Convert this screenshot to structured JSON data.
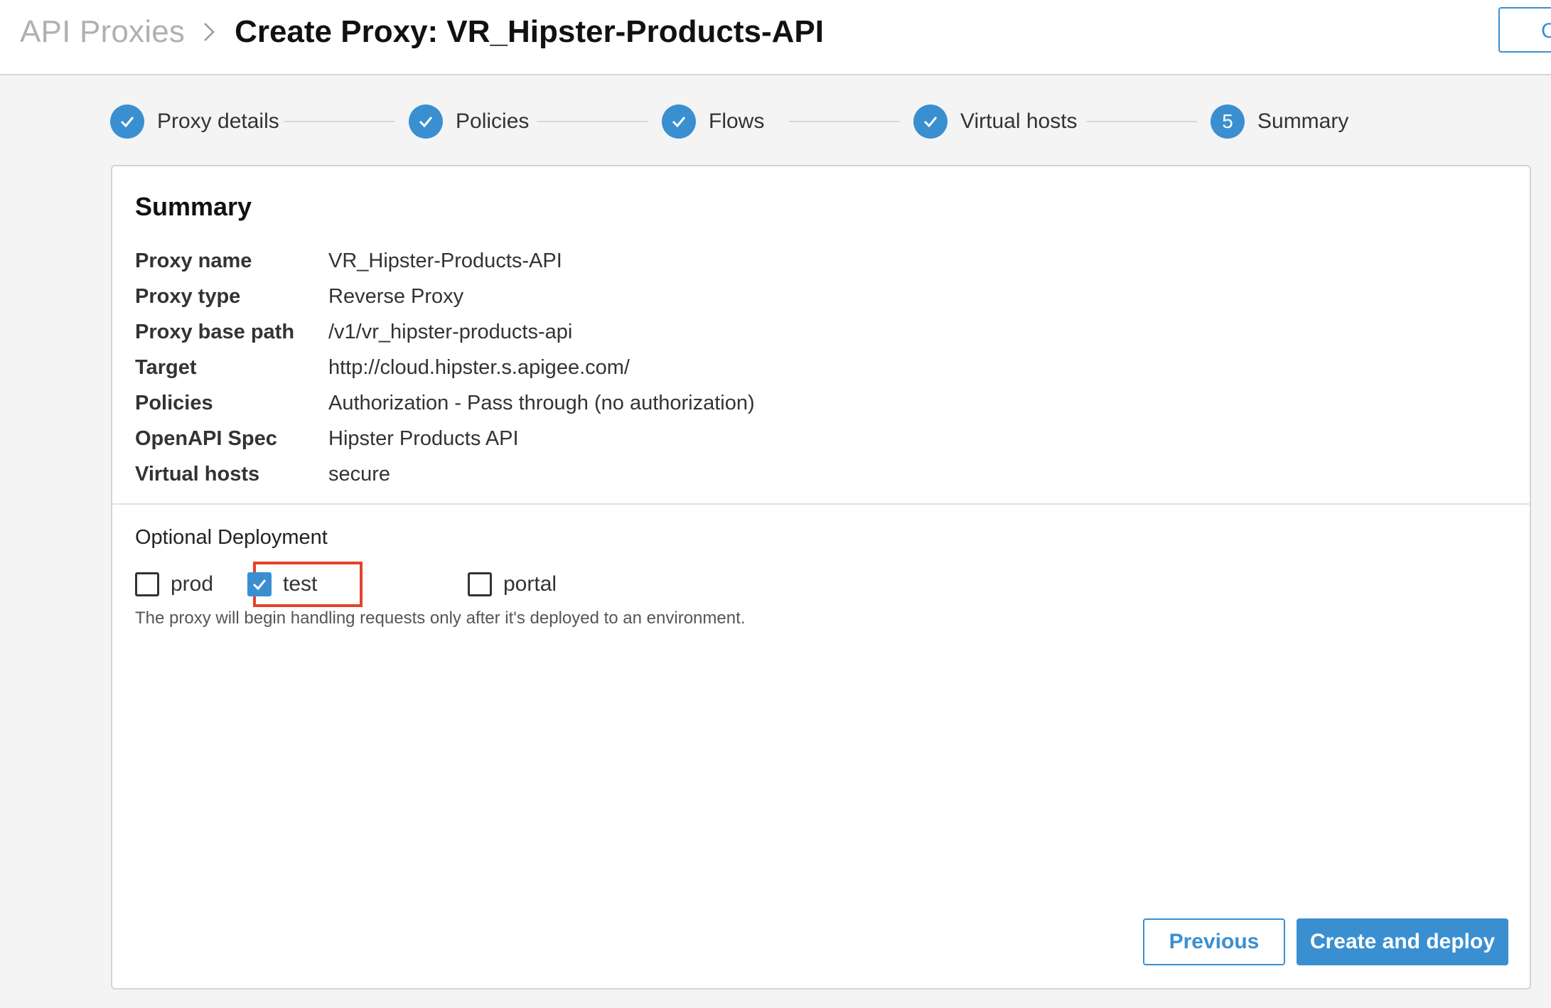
{
  "header": {
    "breadcrumb_parent": "API Proxies",
    "title": "Create Proxy: VR_Hipster-Products-API",
    "right_button_label": "C"
  },
  "stepper": {
    "steps": [
      {
        "label": "Proxy details",
        "state": "completed"
      },
      {
        "label": "Policies",
        "state": "completed"
      },
      {
        "label": "Flows",
        "state": "completed"
      },
      {
        "label": "Virtual hosts",
        "state": "completed"
      },
      {
        "label": "Summary",
        "state": "current",
        "number": "5"
      }
    ]
  },
  "summary": {
    "title": "Summary",
    "rows": [
      {
        "label": "Proxy name",
        "value": "VR_Hipster-Products-API"
      },
      {
        "label": "Proxy type",
        "value": "Reverse Proxy"
      },
      {
        "label": "Proxy base path",
        "value": "/v1/vr_hipster-products-api"
      },
      {
        "label": "Target",
        "value": "http://cloud.hipster.s.apigee.com/"
      },
      {
        "label": "Policies",
        "value": "Authorization - Pass through (no authorization)"
      },
      {
        "label": "OpenAPI Spec",
        "value": "Hipster Products API"
      },
      {
        "label": "Virtual hosts",
        "value": "secure"
      }
    ]
  },
  "deployment": {
    "title": "Optional Deployment",
    "environments": [
      {
        "label": "prod",
        "checked": false
      },
      {
        "label": "test",
        "checked": true,
        "highlighted": true
      },
      {
        "label": "portal",
        "checked": false
      }
    ],
    "helper_text": "The proxy will begin handling requests only after it's deployed to an environment."
  },
  "actions": {
    "previous_label": "Previous",
    "create_deploy_label": "Create and deploy"
  },
  "colors": {
    "accent": "#3a8fd1",
    "highlight": "#e2432c"
  }
}
